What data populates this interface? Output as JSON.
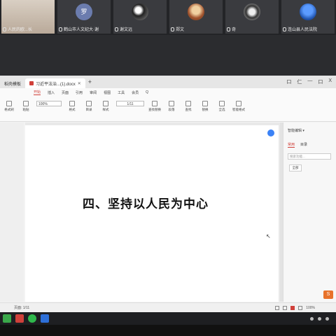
{
  "meeting": {
    "participants": [
      {
        "avatar_text": "",
        "label": "人民的欧...长",
        "style": "cam"
      },
      {
        "avatar_text": "罗",
        "label": "鹤山市人文纪大·谢",
        "style": "initial"
      },
      {
        "avatar_text": "",
        "label": "谢文远",
        "style": "photo1"
      },
      {
        "avatar_text": "",
        "label": "郑文",
        "style": "photo2"
      },
      {
        "avatar_text": "",
        "label": "奇",
        "style": "photo3"
      },
      {
        "avatar_text": "",
        "label": "连山县人民法院",
        "style": "photo4"
      }
    ]
  },
  "app": {
    "tabs": [
      {
        "label": "稻壳模板",
        "active": false
      },
      {
        "label": "习近平法治...(1).docx",
        "active": true
      }
    ],
    "new_tab_label": "+",
    "window_controls": [
      "口",
      "仁",
      "—",
      "口",
      "X"
    ],
    "menu": [
      "开始",
      "插入",
      "页面",
      "引用",
      "审阅",
      "视图",
      "工具",
      "会员",
      "Q"
    ],
    "toolbar": [
      "格式刷",
      "粘贴",
      "100%",
      "格式",
      "目录",
      "样式",
      "查找替换",
      "段落",
      "查找",
      "替换",
      "全选",
      "智能格式"
    ],
    "zoom_value": "100%",
    "page_value": "1/11",
    "document_heading": "四、坚持以人民为中心",
    "right_panel": {
      "title": "智能编辑 ▾",
      "tabs": [
        "常用",
        "目录"
      ],
      "search_placeholder": "搜索功能...",
      "button_label": "全部"
    },
    "status": {
      "left": "页面: 1/11",
      "right_items": [
        "100%"
      ]
    }
  },
  "taskbar": {
    "icons": [
      "grid-icon",
      "wps-icon",
      "wechat-icon",
      "meeting-icon"
    ]
  },
  "colors": {
    "accent": "#d0403a",
    "taskbar": "#1e1f22",
    "wps_orange": "#e8722a"
  }
}
